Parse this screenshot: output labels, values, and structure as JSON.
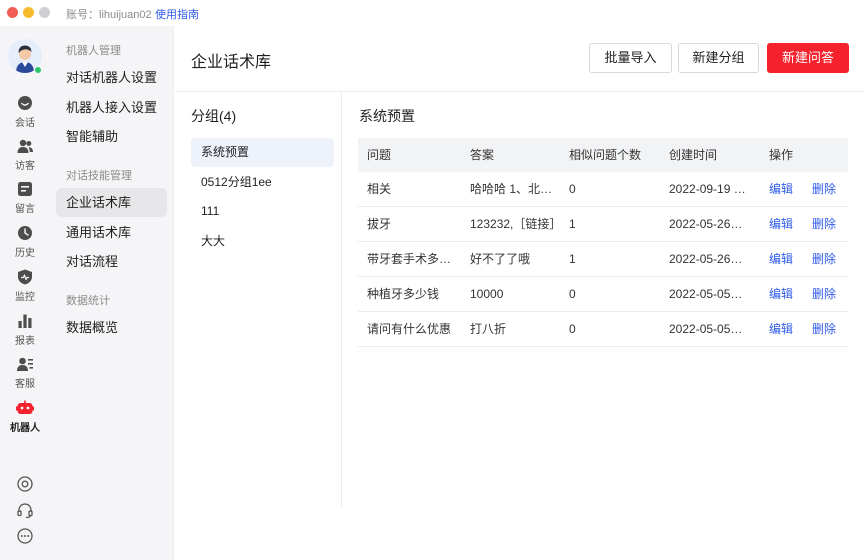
{
  "titlebar": {
    "account": "账号：lihuijuan02",
    "guide_link": "使用指南"
  },
  "rail": {
    "items": [
      {
        "label": "会话",
        "icon": "chat-icon"
      },
      {
        "label": "访客",
        "icon": "visitors-icon"
      },
      {
        "label": "留言",
        "icon": "message-icon"
      },
      {
        "label": "历史",
        "icon": "history-icon"
      },
      {
        "label": "监控",
        "icon": "monitor-icon"
      },
      {
        "label": "报表",
        "icon": "report-icon"
      },
      {
        "label": "客服",
        "icon": "agent-icon"
      },
      {
        "label": "机器人",
        "icon": "robot-icon"
      }
    ],
    "active_index": 7,
    "bottom_icons": [
      "settings-icon",
      "headset-icon",
      "more-icon"
    ]
  },
  "menu": {
    "sections": [
      {
        "heading": "机器人管理",
        "items": [
          "对话机器人设置",
          "机器人接入设置",
          "智能辅助"
        ]
      },
      {
        "heading": "对话技能管理",
        "items": [
          "企业话术库",
          "通用话术库",
          "对话流程"
        ]
      },
      {
        "heading": "数据统计",
        "items": [
          "数据概览"
        ]
      }
    ],
    "active_item": "企业话术库"
  },
  "main": {
    "title": "企业话术库",
    "buttons": {
      "import": "批量导入",
      "new_group": "新建分组",
      "new_qa": "新建问答"
    },
    "groups_title": "分组(4)",
    "groups": [
      "系统预置",
      "0512分组1ee",
      "111",
      "大大"
    ],
    "active_group": 0,
    "section_title": "系统预置",
    "table": {
      "headers": [
        "问题",
        "答案",
        "相似问题个数",
        "创建时间",
        "操作"
      ],
      "rows": [
        {
          "question": "相关",
          "answer": "哈哈哈 1、北…",
          "similar": "0",
          "created": "2022-09-19 …",
          "edit": "编辑",
          "delete": "删除"
        },
        {
          "question": "拔牙",
          "answer": "123232,［链接］",
          "similar": "1",
          "created": "2022-05-26…",
          "edit": "编辑",
          "delete": "删除"
        },
        {
          "question": "带牙套手术多…",
          "answer": "好不了了哦",
          "similar": "1",
          "created": "2022-05-26…",
          "edit": "编辑",
          "delete": "删除"
        },
        {
          "question": "种植牙多少钱",
          "answer": "10000",
          "similar": "0",
          "created": "2022-05-05…",
          "edit": "编辑",
          "delete": "删除"
        },
        {
          "question": "请问有什么优惠",
          "answer": "打八折",
          "similar": "0",
          "created": "2022-05-05…",
          "edit": "编辑",
          "delete": "删除"
        }
      ]
    }
  },
  "colors": {
    "primary": "#f5222d",
    "link": "#2f5bea",
    "sidebar_bg": "#f5f5f7",
    "active_group_bg": "#eef2fb"
  }
}
